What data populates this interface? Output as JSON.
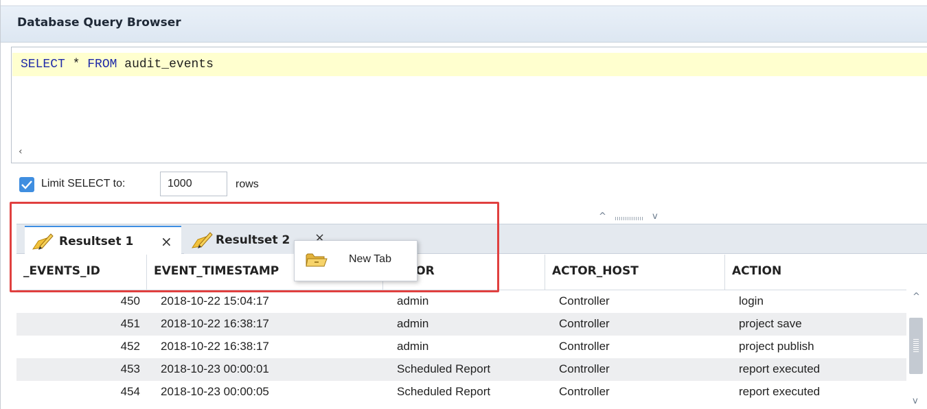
{
  "window": {
    "title": "Database Query Browser"
  },
  "editor": {
    "keyword_select": "SELECT",
    "star": "*",
    "keyword_from": "FROM",
    "table": "audit_events",
    "hscroll_left": "‹"
  },
  "limit": {
    "checked": true,
    "label": "Limit SELECT to:",
    "value": "1000",
    "unit": "rows"
  },
  "splitter": {
    "up": "^",
    "down": "v"
  },
  "tabs": [
    {
      "label": "Resultset 1",
      "close": "×",
      "active": true
    },
    {
      "label": "Resultset 2",
      "close": "×",
      "active": false
    }
  ],
  "context_menu": {
    "items": [
      {
        "label": "New Tab",
        "icon": "folder-icon"
      }
    ]
  },
  "grid": {
    "columns": [
      "_EVENTS_ID",
      "EVENT_TIMESTAMP",
      "ACTOR",
      "ACTOR_HOST",
      "ACTION"
    ],
    "rows": [
      [
        "450",
        "2018-10-22 15:04:17",
        "admin",
        "Controller",
        "login"
      ],
      [
        "451",
        "2018-10-22 16:38:17",
        "admin",
        "Controller",
        "project save"
      ],
      [
        "452",
        "2018-10-22 16:38:17",
        "admin",
        "Controller",
        "project publish"
      ],
      [
        "453",
        "2018-10-23 00:00:01",
        "Scheduled Report",
        "Controller",
        "report executed"
      ],
      [
        "454",
        "2018-10-23 00:00:05",
        "Scheduled Report",
        "Controller",
        "report executed"
      ]
    ]
  },
  "colors": {
    "accent": "#3d8ee2",
    "highlight": "#e0403f",
    "editor_line": "#ffffcf"
  }
}
